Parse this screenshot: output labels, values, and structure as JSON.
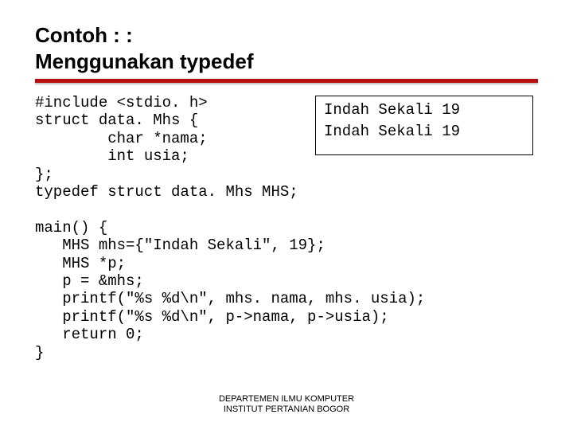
{
  "title_line1": "Contoh : :",
  "title_line2": "Menggunakan typedef",
  "code": "#include <stdio. h>\nstruct data. Mhs {\n        char *nama;\n        int usia;\n};\ntypedef struct data. Mhs MHS;\n\nmain() {\n   MHS mhs={\"Indah Sekali\", 19};\n   MHS *p;\n   p = &mhs;\n   printf(\"%s %d\\n\", mhs. nama, mhs. usia);\n   printf(\"%s %d\\n\", p->nama, p->usia);\n   return 0;\n}",
  "output": "Indah Sekali 19\nIndah Sekali 19",
  "footer_line1": "DEPARTEMEN ILMU KOMPUTER",
  "footer_line2": "INSTITUT PERTANIAN BOGOR"
}
